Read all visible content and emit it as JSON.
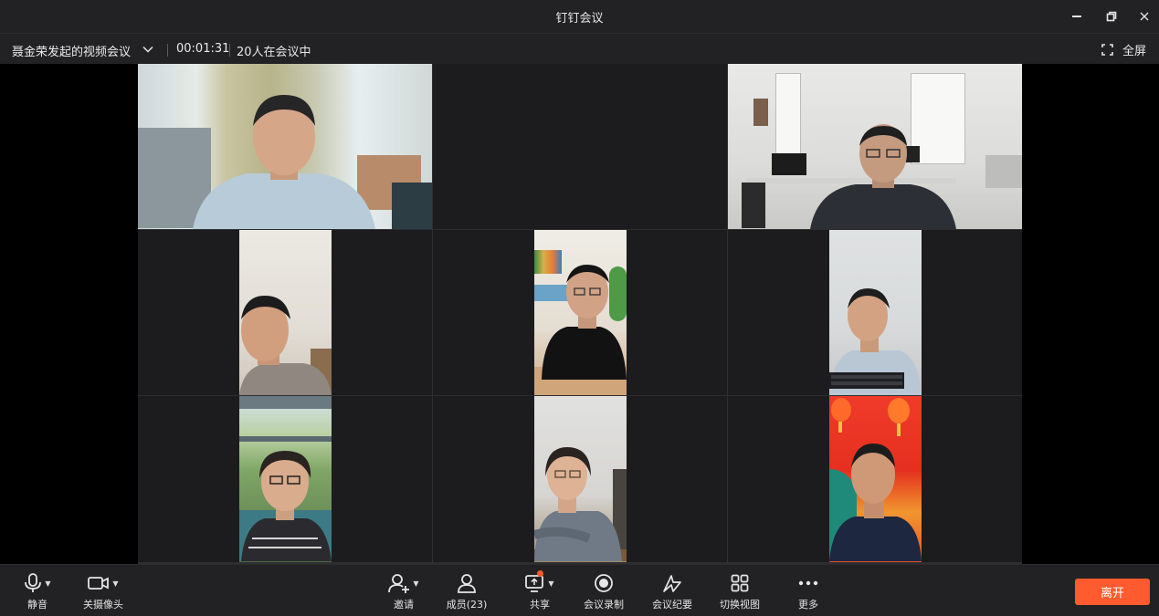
{
  "window": {
    "title": "钉钉会议",
    "controls": [
      "minimize-icon",
      "restore-icon",
      "close-icon"
    ]
  },
  "infobar": {
    "meeting_title": "聂金荣发起的视频会议",
    "timer": "00:01:31",
    "participants_status": "20人在会议中",
    "fullscreen_label": "全屏"
  },
  "grid": {
    "rows": 3,
    "cols": 3,
    "tiles": [
      {
        "video": "landscape",
        "scene": "office-window-curtains"
      },
      {
        "video": "none"
      },
      {
        "video": "landscape",
        "scene": "bright-office"
      },
      {
        "video": "portrait",
        "scene": "white-wall"
      },
      {
        "video": "portrait",
        "scene": "bookshelf"
      },
      {
        "video": "portrait",
        "scene": "desk-keyboard"
      },
      {
        "video": "portrait",
        "scene": "window-greenery"
      },
      {
        "video": "portrait",
        "scene": "grey-room"
      },
      {
        "video": "portrait",
        "scene": "red-festive-lanterns"
      }
    ]
  },
  "toolbar": {
    "mute_label": "静音",
    "camera_label": "关摄像头",
    "invite_label": "邀请",
    "members_label": "成员(23)",
    "share_label": "共享",
    "record_label": "会议录制",
    "minutes_label": "会议纪要",
    "view_label": "切换视图",
    "more_label": "更多",
    "leave_label": "离开"
  },
  "colors": {
    "accent": "#ff5b2e",
    "background": "#1b1b1d",
    "notification_dot": "#ff5a2a"
  }
}
